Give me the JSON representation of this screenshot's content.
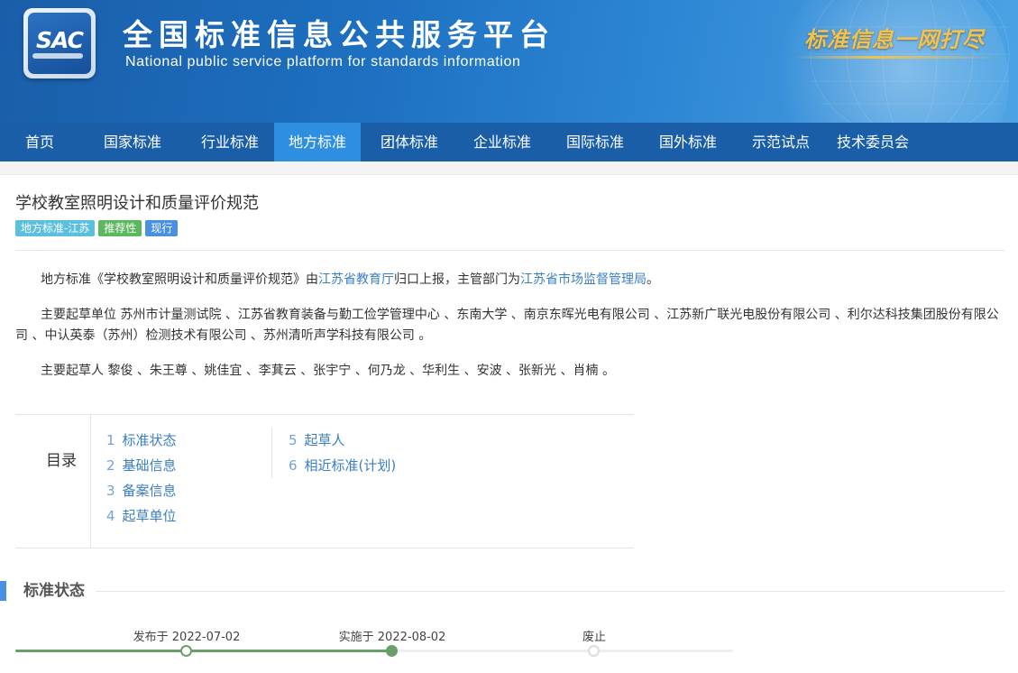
{
  "header": {
    "logo_text": "SAC",
    "title_cn": "全国标准信息公共服务平台",
    "title_en": "National public service platform  for standards information",
    "slogan": "标准信息一网打尽"
  },
  "nav": {
    "items": [
      {
        "label": "首页",
        "active": false
      },
      {
        "label": "国家标准",
        "active": false
      },
      {
        "label": "行业标准",
        "active": false
      },
      {
        "label": "地方标准",
        "active": true
      },
      {
        "label": "团体标准",
        "active": false
      },
      {
        "label": "企业标准",
        "active": false
      },
      {
        "label": "国际标准",
        "active": false
      },
      {
        "label": "国外标准",
        "active": false
      },
      {
        "label": "示范试点",
        "active": false
      },
      {
        "label": "技术委员会",
        "active": false
      }
    ]
  },
  "standard": {
    "title": "学校教室照明设计和质量评价规范",
    "tags": [
      "地方标准-江苏",
      "推荐性",
      "现行"
    ],
    "intro": {
      "prefix": "地方标准《学校教室照明设计和质量评价规范》由",
      "proposer": "江苏省教育厅",
      "middle": "归口上报，主管部门为",
      "authority": "江苏省市场监督管理局",
      "suffix": "。"
    },
    "drafting_units_label": "主要起草单位",
    "drafting_units": "苏州市计量测试院 、江苏省教育装备与勤工俭学管理中心 、东南大学 、南京东晖光电有限公司 、江苏新广联光电股份有限公司 、利尔达科技集团股份有限公司 、中认英泰（苏州）检测技术有限公司 、苏州清听声学科技有限公司 。",
    "drafters_label": "主要起草人",
    "drafters": "黎俊 、朱王尊 、姚佳宜 、李萁云 、张宇宁 、何乃龙 、华利生 、安波 、张新光 、肖楠 。"
  },
  "toc": {
    "label": "目录",
    "col1": [
      {
        "num": "1",
        "label": "标准状态"
      },
      {
        "num": "2",
        "label": "基础信息"
      },
      {
        "num": "3",
        "label": "备案信息"
      },
      {
        "num": "4",
        "label": "起草单位"
      }
    ],
    "col2": [
      {
        "num": "5",
        "label": "起草人"
      },
      {
        "num": "6",
        "label": "相近标准(计划)"
      }
    ]
  },
  "status_section": {
    "title": "标准状态",
    "timeline": [
      {
        "label": "发布于 2022-07-02",
        "state": "done"
      },
      {
        "label": "实施于 2022-08-02",
        "state": "current"
      },
      {
        "label": "废止",
        "state": "future"
      }
    ]
  },
  "colors": {
    "brand_blue": "#1a5ea8",
    "nav_active": "#2e8fe0",
    "link_blue": "#3a7ec6",
    "timeline_green": "#6a9e6a"
  }
}
